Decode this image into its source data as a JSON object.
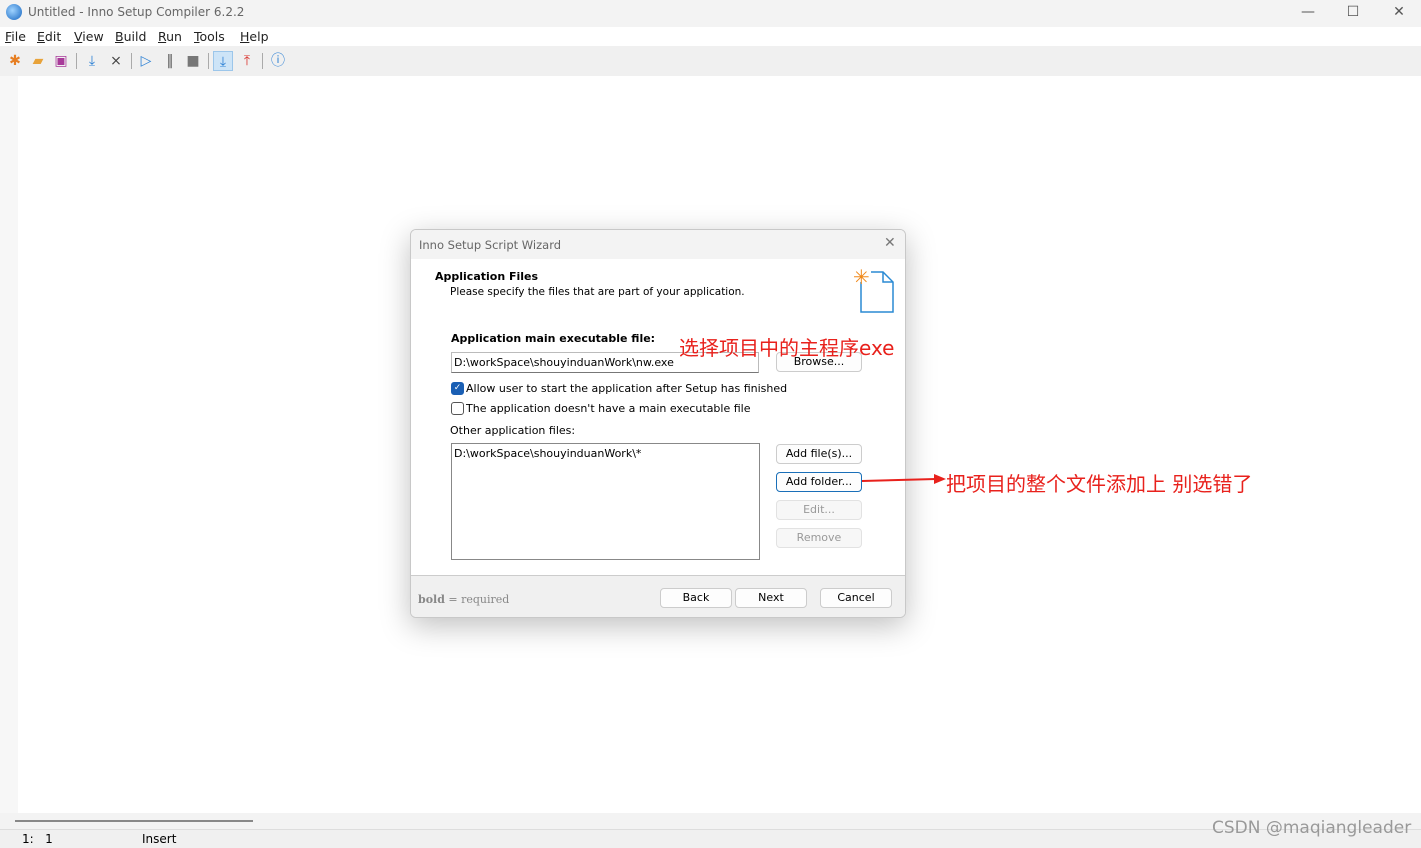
{
  "window": {
    "title": "Untitled - Inno Setup Compiler 6.2.2",
    "minimize": "—",
    "maximize": "☐",
    "close": "✕"
  },
  "menu": [
    "File",
    "Edit",
    "View",
    "Build",
    "Run",
    "Tools",
    "Help"
  ],
  "toolbar": [
    "new-icon",
    "open-icon",
    "save-icon",
    "compile-icon",
    "stop-compile-icon",
    "run-icon",
    "pause-icon",
    "terminate-icon",
    "target-install-icon",
    "target-uninstall-icon",
    "help-icon"
  ],
  "status": {
    "position": "1:   1",
    "mode": "Insert"
  },
  "dialog": {
    "title": "Inno Setup Script Wizard",
    "heading": "Application Files",
    "subheading": "Please specify the files that are part of your application.",
    "main_exe_label": "Application main executable file:",
    "main_exe_value": "D:\\workSpace\\shouyinduanWork\\nw.exe",
    "browse": "Browse...",
    "allow_start": {
      "label": "Allow user to start the application after Setup has finished",
      "checked": true
    },
    "no_main_exe": {
      "label": "The application doesn't have a main executable file",
      "checked": false
    },
    "other_files_label": "Other application files:",
    "other_files": [
      "D:\\workSpace\\shouyinduanWork\\*"
    ],
    "add_files": "Add file(s)...",
    "add_folder": "Add folder...",
    "edit": "Edit...",
    "remove": "Remove",
    "legend_bold": "bold",
    "legend_rest": " = required",
    "back": "Back",
    "next": "Next",
    "cancel": "Cancel"
  },
  "annotations": {
    "exe": "选择项目中的主程序exe",
    "folder": "把项目的整个文件添加上 别选错了",
    "color": "#e8211c"
  },
  "watermark": "CSDN @maqiangleader"
}
